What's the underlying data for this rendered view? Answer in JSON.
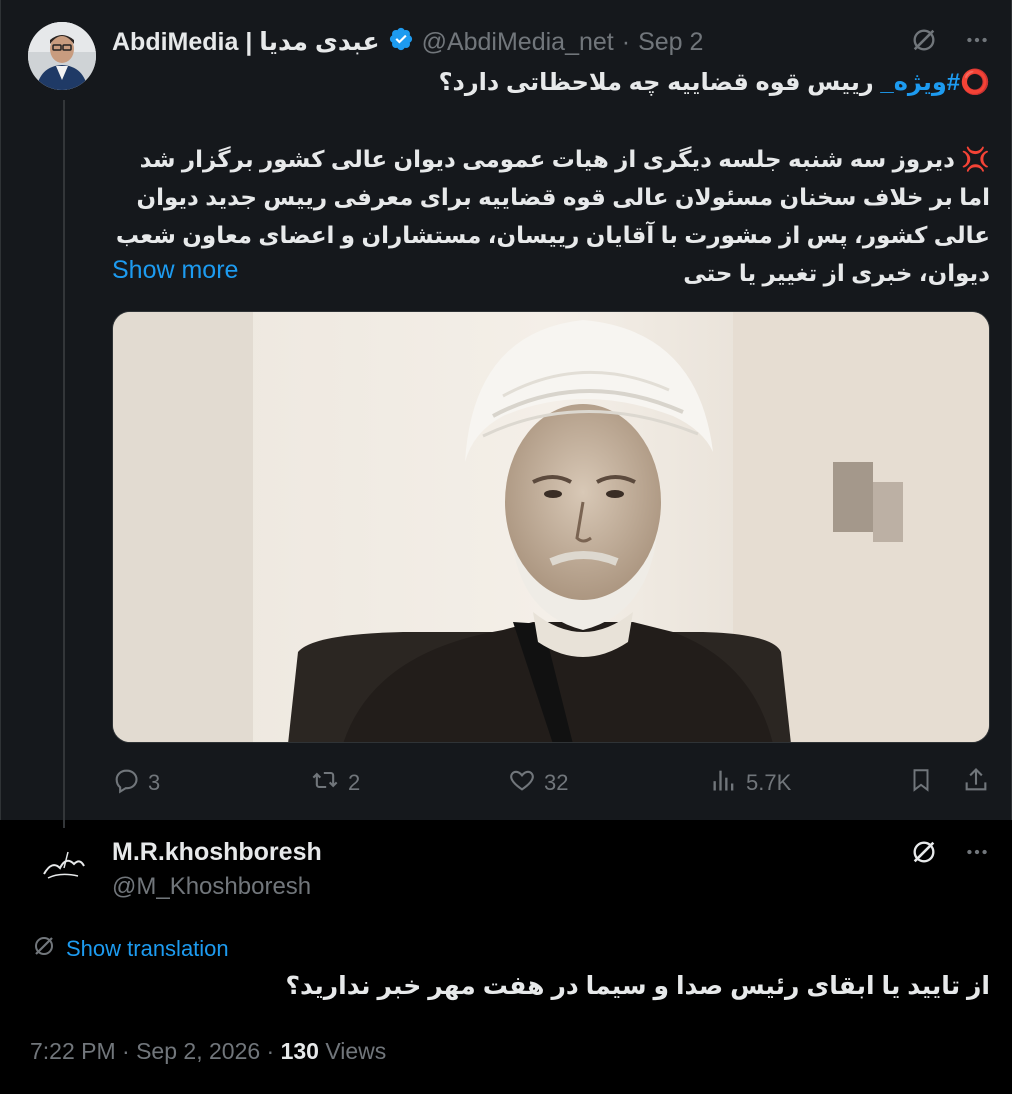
{
  "tweet": {
    "display_name": "AbdiMedia | عبدی مدیا",
    "handle": "@AbdiMedia_net",
    "separator": "·",
    "date": "Sep 2",
    "first_line_prefix": "⭕",
    "hashtag": "#ویژه_",
    "first_line_rest": "  رییس قوه قضاییه چه ملاحظاتی دارد؟",
    "body": "💢 دیروز سه شنبه جلسه دیگری از هیات عمومی دیوان عالی کشور برگزار شد اما بر خلاف سخنان مسئولان عالی قوه قضاییه برای معرفی رییس جدید دیوان عالی کشور، پس از مشورت با آقایان رییسان، مستشاران و اعضای معاون شعب دیوان، خبری از تغییر یا حتی",
    "show_more": "Show more",
    "stats": {
      "replies": "3",
      "reposts": "2",
      "likes": "32",
      "views": "5.7K"
    }
  },
  "reply": {
    "display_name": "M.R.khoshboresh",
    "handle": "@M_Khoshboresh",
    "show_translation": "Show translation",
    "text": "از تایید یا ابقای رئیس صدا و سیما در هفت مهر خبر ندارید؟",
    "time": "7:22 PM · Sep 2, 2026 · ",
    "views_count": "130",
    "views_label": " Views"
  },
  "colors": {
    "accent": "#1d9bf0",
    "muted": "#71767b",
    "background": "#000000",
    "quoted_background": "#15181c",
    "text": "#e7e9ea"
  },
  "icons": [
    "grok-icon",
    "more-icon",
    "verified-badge-icon",
    "reply-icon",
    "repost-icon",
    "like-icon",
    "views-icon",
    "bookmark-icon",
    "share-icon",
    "translate-icon"
  ]
}
